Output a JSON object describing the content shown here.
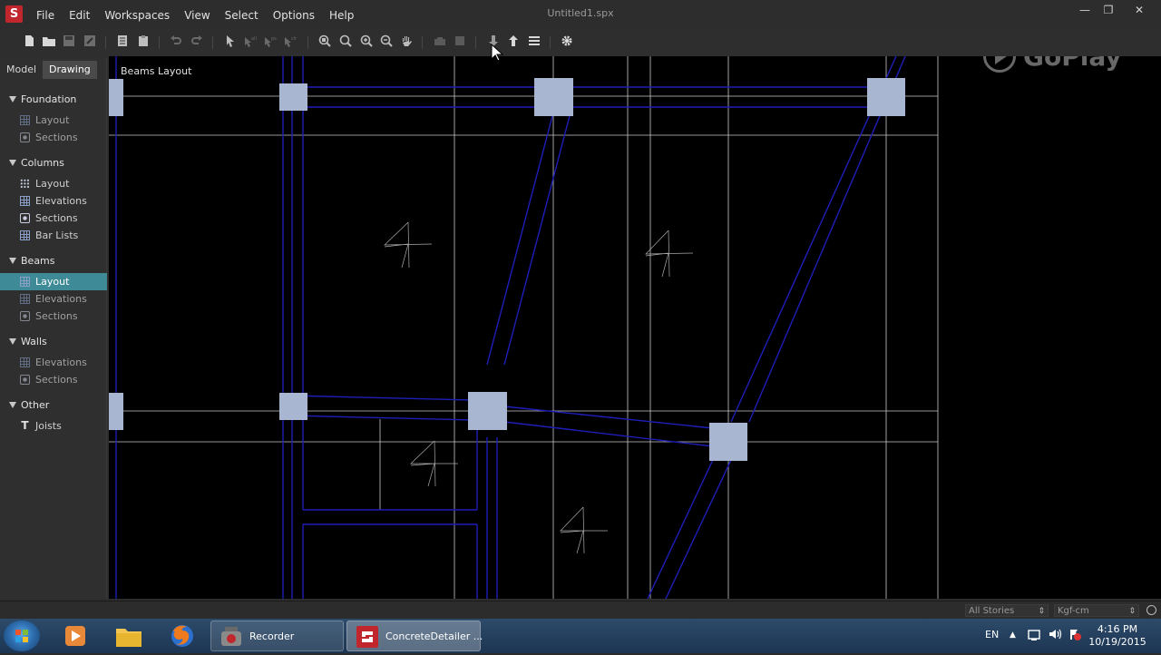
{
  "window": {
    "title": "Untitled1.spx",
    "app_logo_letter": "S",
    "controls": {
      "minimize": "—",
      "maximize": "❐",
      "close": "✕"
    }
  },
  "menu": [
    "File",
    "Edit",
    "Workspaces",
    "View",
    "Select",
    "Options",
    "Help"
  ],
  "toolbar": {
    "icons": [
      "new-file-icon",
      "open-folder-icon",
      "save-icon",
      "save-as-icon",
      "copy-icon",
      "paste-icon",
      "undo-icon",
      "redo-icon",
      "select-arrow-icon",
      "select-all-icon",
      "select-ps-icon",
      "select-clr-icon",
      "zoom-extents-icon",
      "zoom-window-icon",
      "zoom-in-icon",
      "zoom-out-icon",
      "pan-hand-icon",
      "story-icon",
      "block-icon",
      "move-down-icon",
      "move-up-icon",
      "list-icon",
      "settings-gear-icon"
    ]
  },
  "panel": {
    "tabs": [
      "Model",
      "Drawing"
    ],
    "active_tab": "Drawing",
    "sections": [
      {
        "label": "Foundation",
        "items": [
          {
            "label": "Layout",
            "icon": "grid-icon"
          },
          {
            "label": "Sections",
            "icon": "section-icon"
          }
        ]
      },
      {
        "label": "Columns",
        "items": [
          {
            "label": "Layout",
            "icon": "dot-grid-icon"
          },
          {
            "label": "Elevations",
            "icon": "grid-icon"
          },
          {
            "label": "Sections",
            "icon": "section-icon"
          },
          {
            "label": "Bar Lists",
            "icon": "grid-icon"
          }
        ]
      },
      {
        "label": "Beams",
        "items": [
          {
            "label": "Layout",
            "icon": "grid-icon",
            "active": true
          },
          {
            "label": "Elevations",
            "icon": "grid-icon"
          },
          {
            "label": "Sections",
            "icon": "section-icon"
          }
        ]
      },
      {
        "label": "Walls",
        "items": [
          {
            "label": "Elevations",
            "icon": "grid-icon"
          },
          {
            "label": "Sections",
            "icon": "section-icon"
          }
        ]
      },
      {
        "label": "Other",
        "items": [
          {
            "label": "Joists",
            "icon": "t-icon"
          }
        ]
      }
    ]
  },
  "canvas": {
    "title": "Beams Layout",
    "watermark": "GoPlay"
  },
  "status": {
    "story_select": "All Stories",
    "unit_select": "Kgf-cm"
  },
  "taskbar": {
    "apps": [
      {
        "label": "Recorder",
        "active": false
      },
      {
        "label": "ConcreteDetailer ...",
        "active": true
      }
    ],
    "language": "EN",
    "clock": {
      "time": "4:16 PM",
      "date": "10/19/2015"
    }
  },
  "colors": {
    "canvas_bg": "#000000",
    "beam_lines": "#1a1ab4",
    "grid_lines": "#c8c8c8",
    "column_fill": "#a9b6d2",
    "active_item": "#3e8a96"
  }
}
